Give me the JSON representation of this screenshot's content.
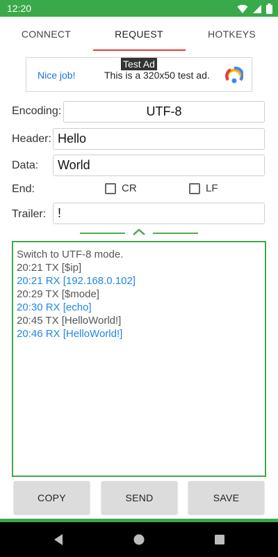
{
  "status_bar": {
    "time": "12:20"
  },
  "tabs": [
    {
      "label": "CONNECT"
    },
    {
      "label": "REQUEST"
    },
    {
      "label": "HOTKEYS"
    }
  ],
  "ad": {
    "left_text": "Nice job!",
    "middle_text": "This is a 320x50 test ad.",
    "badge": "Test Ad"
  },
  "form": {
    "encoding_label": "Encoding:",
    "encoding_value": "UTF-8",
    "header_label": "Header:",
    "header_value": "Hello",
    "data_label": "Data:",
    "data_value": "World",
    "end_label": "End:",
    "cr_label": "CR",
    "lf_label": "LF",
    "trailer_label": "Trailer:",
    "trailer_value": "!"
  },
  "log": [
    {
      "text": "Switch to UTF-8 mode.",
      "color": "#555555"
    },
    {
      "text": "20:21 TX [$ip]",
      "color": "#555555"
    },
    {
      "text": "20:21 RX [192.168.0.102]",
      "color": "#1e88e5"
    },
    {
      "text": "20:29 TX [$mode]",
      "color": "#555555"
    },
    {
      "text": "20:30 RX [echo]",
      "color": "#1e88e5"
    },
    {
      "text": "20:45 TX [HelloWorld!]",
      "color": "#555555"
    },
    {
      "text": "20:46 RX [HelloWorld!]",
      "color": "#1e88e5"
    }
  ],
  "buttons": {
    "copy": "COPY",
    "send": "SEND",
    "save": "SAVE"
  },
  "colors": {
    "accent_green": "#3aa94a",
    "tab_indicator": "#e53935",
    "rx_blue": "#1e88e5"
  }
}
